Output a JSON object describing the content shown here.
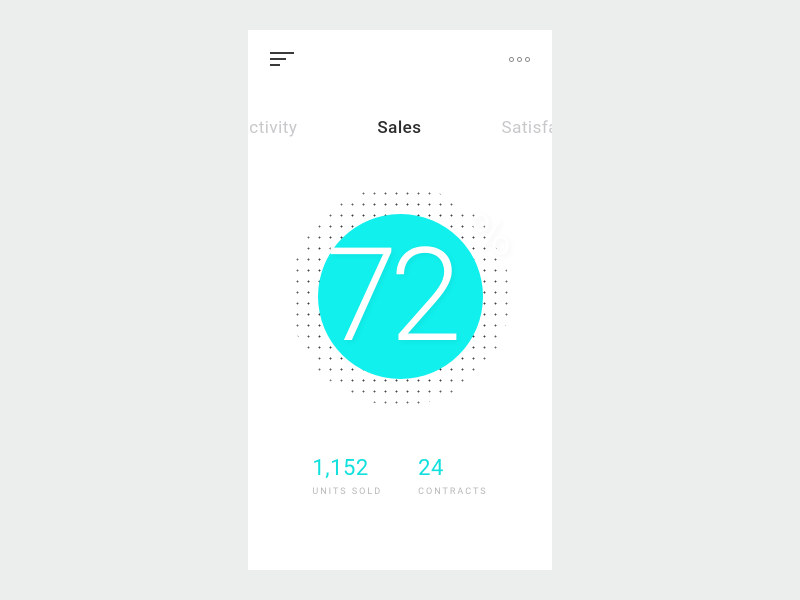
{
  "tabs": {
    "left": "Productivity",
    "center": "Sales",
    "right": "Satisfaction"
  },
  "main": {
    "percentage": "72",
    "percent_symbol": "%"
  },
  "stats": {
    "units_value": "1,152",
    "units_label": "Units Sold",
    "contracts_value": "24",
    "contracts_label": "Contracts"
  },
  "colors": {
    "accent": "#11f0ed"
  }
}
